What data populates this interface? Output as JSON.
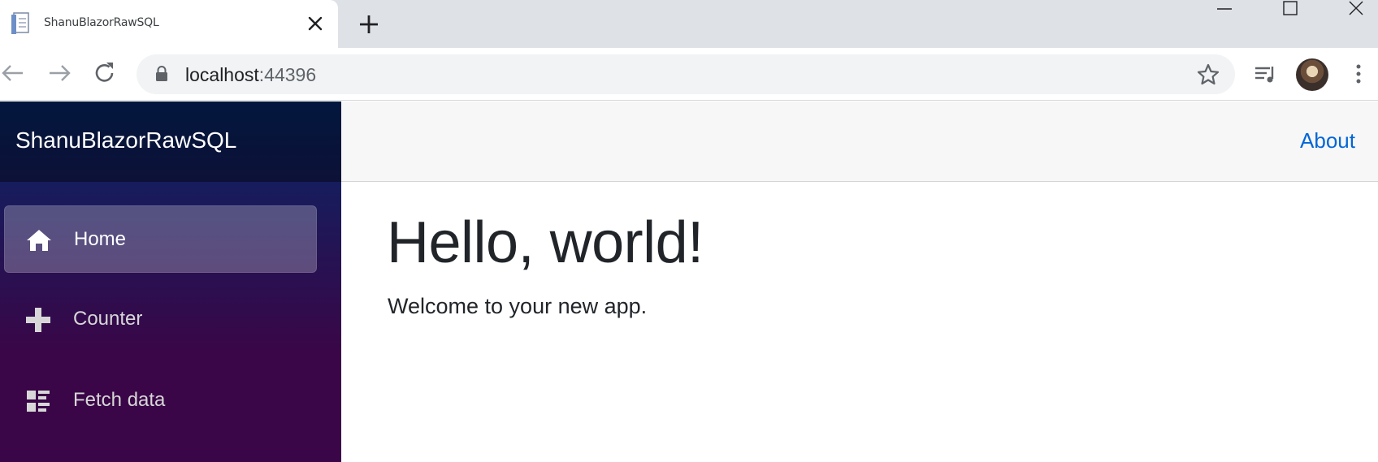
{
  "browser": {
    "tab": {
      "title": "ShanuBlazorRawSQL"
    },
    "address_bar": {
      "host": "localhost",
      "port": ":44396"
    },
    "icons": {
      "back": "arrow-left-icon",
      "forward": "arrow-right-icon",
      "reload": "reload-icon",
      "lock": "lock-icon",
      "bookmark": "star-icon",
      "media": "media-queue-icon",
      "menu": "kebab-menu-icon",
      "close_tab": "close-icon",
      "new_tab": "plus-icon"
    }
  },
  "app": {
    "brand": "ShanuBlazorRawSQL",
    "nav": [
      {
        "label": "Home",
        "icon": "home-icon",
        "active": true
      },
      {
        "label": "Counter",
        "icon": "plus-icon",
        "active": false
      },
      {
        "label": "Fetch data",
        "icon": "list-rich-icon",
        "active": false
      }
    ],
    "top_row": {
      "about_label": "About"
    },
    "content": {
      "title": "Hello, world!",
      "welcome_text": "Welcome to your new app."
    }
  },
  "colors": {
    "sidebar_top": "#052767",
    "sidebar_bottom": "#3a0647",
    "link": "#0366d6",
    "text": "#212529"
  }
}
